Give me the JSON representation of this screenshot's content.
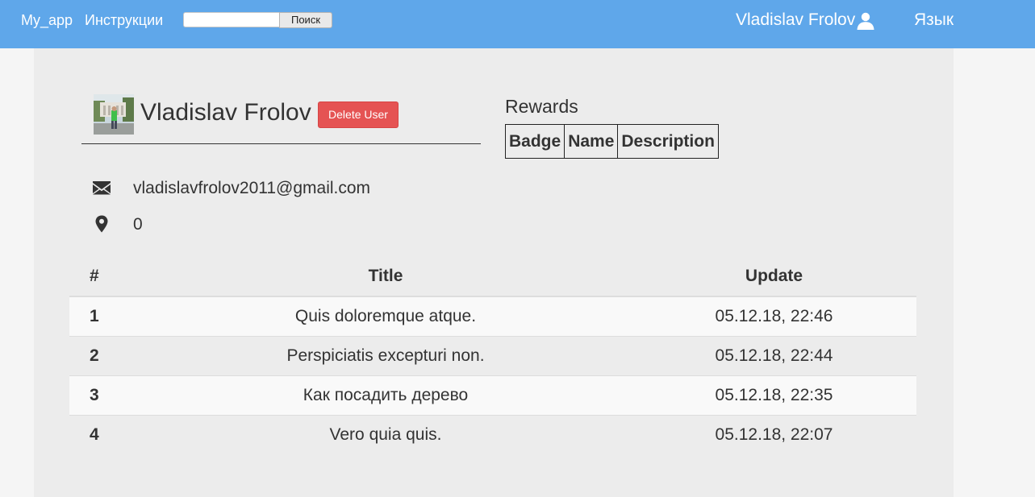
{
  "navbar": {
    "brand": "My_app",
    "instructions_label": "Инструкции",
    "search_value": "",
    "search_button_label": "Поиск",
    "user_name": "Vladislav Frolov",
    "user_icon": "user-icon",
    "language_label": "Язык",
    "background_color": "#5fa7ea"
  },
  "profile": {
    "name": "Vladislav Frolov",
    "delete_button_label": "Delete User",
    "delete_button_color": "#e55353",
    "avatar_icon": "avatar-photo",
    "email": "vladislavfrolov2011@gmail.com",
    "email_icon": "envelope-icon",
    "location": "0",
    "location_icon": "map-marker-icon"
  },
  "rewards": {
    "title": "Rewards",
    "columns": [
      "Badge",
      "Name",
      "Description"
    ]
  },
  "posts": {
    "columns": [
      "#",
      "Title",
      "Update"
    ],
    "rows": [
      {
        "num": "1",
        "title": "Quis doloremque atque.",
        "update": "05.12.18, 22:46"
      },
      {
        "num": "2",
        "title": "Perspiciatis excepturi non.",
        "update": "05.12.18, 22:44"
      },
      {
        "num": "3",
        "title": "Как посадить дерево",
        "update": "05.12.18, 22:35"
      },
      {
        "num": "4",
        "title": "Vero quia quis.",
        "update": "05.12.18, 22:07"
      }
    ]
  }
}
